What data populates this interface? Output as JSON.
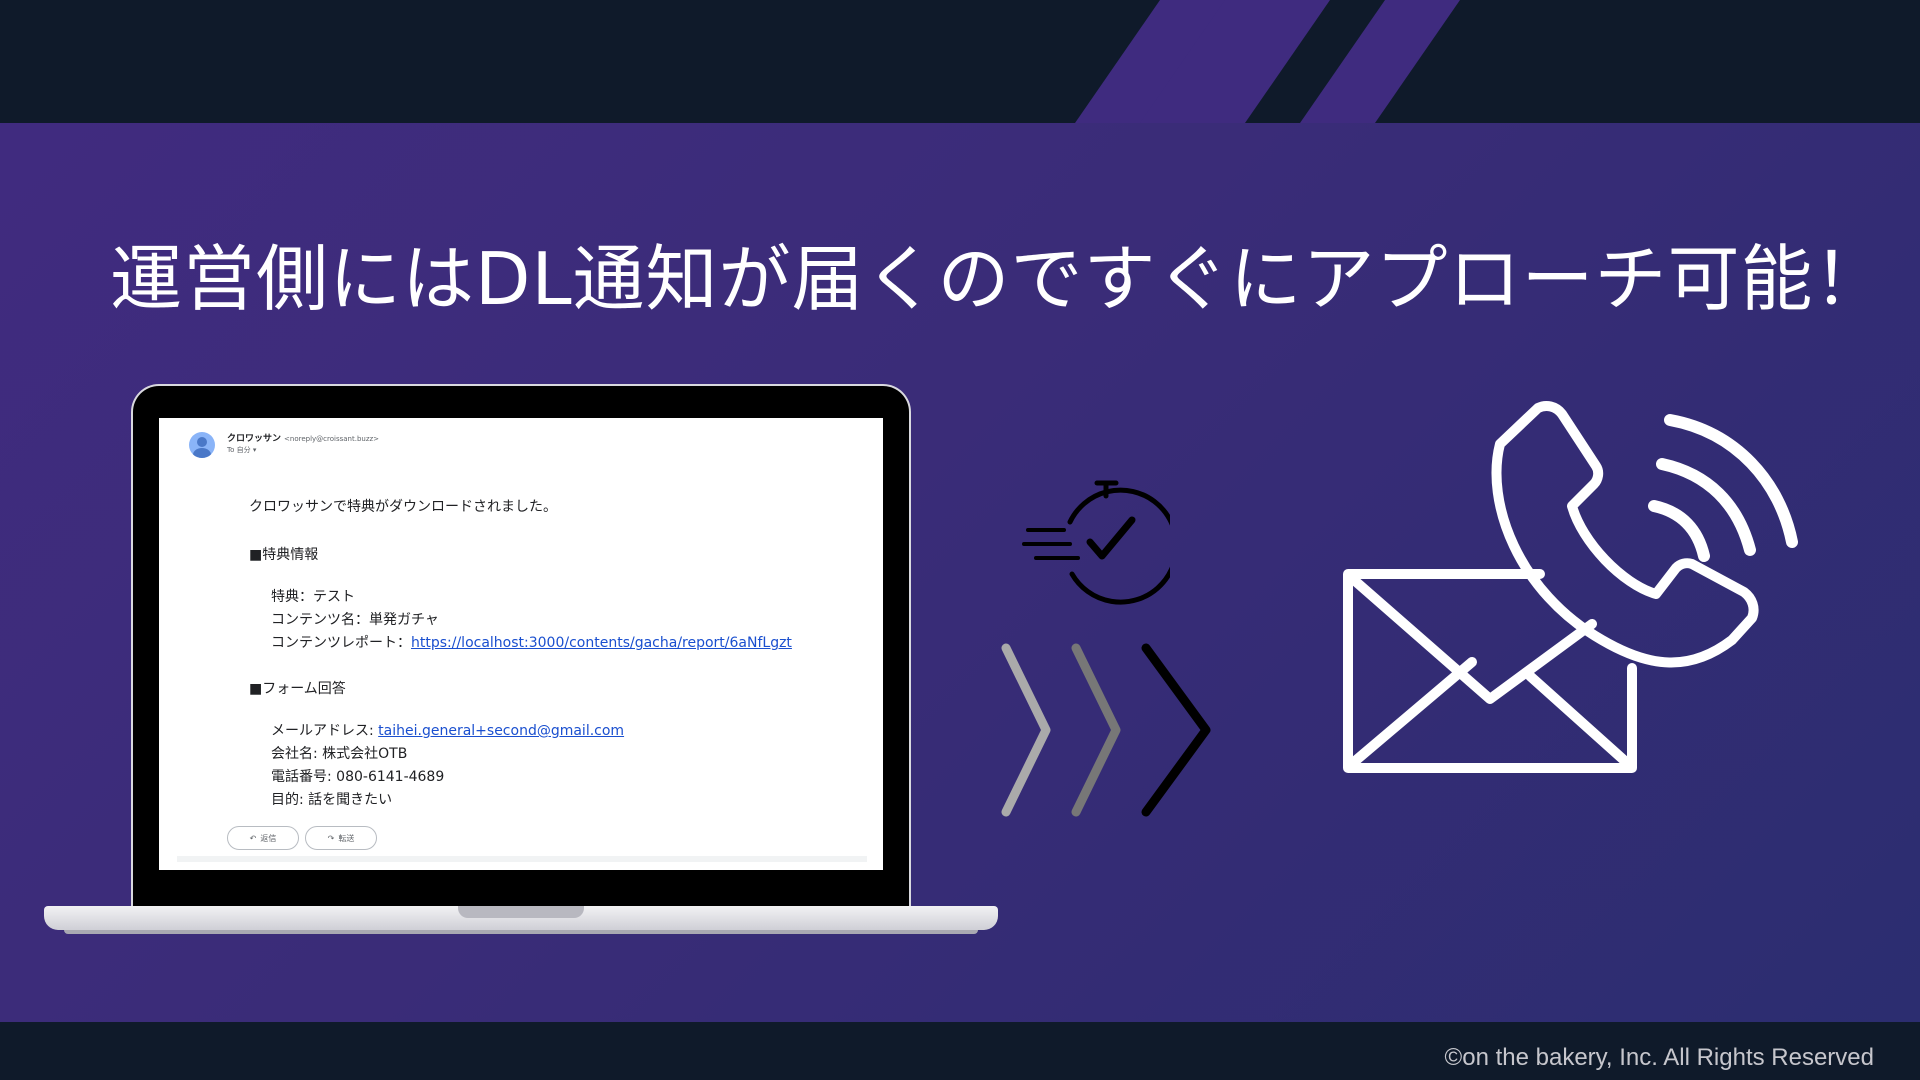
{
  "headline": "運営側にはDL通知が届くのですぐにアプローチ可能！",
  "copyright": "©on the bakery, Inc. All Rights Reserved",
  "email": {
    "sender_name": "クロワッサン",
    "sender_address": "<noreply@croissant.buzz>",
    "recipient": "To 自分 ▾",
    "intro": "クロワッサンで特典がダウンロードされました。",
    "section_perk": "■特典情報",
    "perk_line": "特典：テスト",
    "content_name_line": "コンテンツ名：単発ガチャ",
    "report_label": "コンテンツレポート：",
    "report_link": "https://localhost:3000/contents/gacha/report/6aNfLgzt",
    "section_form": "■フォーム回答",
    "email_label": "メールアドレス: ",
    "email_link": "taihei.general+second@gmail.com",
    "company_line": "会社名: 株式会社OTB",
    "phone_line": "電話番号: 080-6141-4689",
    "purpose_line": "目的: 話を聞きたい",
    "reply_label": "返信",
    "forward_label": "転送"
  },
  "icons": {
    "timer": "stopwatch-check-icon",
    "arrows": "triple-chevron-right-icon",
    "contact": "mail-phone-icon"
  },
  "colors": {
    "background_start": "#412b80",
    "background_end": "#2b2d70",
    "band": "#0f1a2a",
    "link": "#1a4fcf"
  }
}
